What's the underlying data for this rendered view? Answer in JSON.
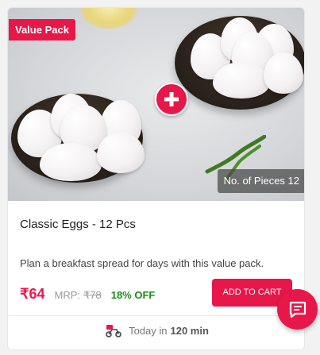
{
  "product": {
    "badge": "Value Pack",
    "pieces_label": "No. of Pieces 12",
    "title": "Classic Eggs - 12 Pcs",
    "description": "Plan a breakfast spread for days with this value pack.",
    "price": "₹64",
    "mrp_label": "MRP:",
    "mrp": "₹78",
    "discount": "18% OFF",
    "add_to_cart": "ADD TO CART"
  },
  "delivery": {
    "prefix": "Today in",
    "time": "120 min",
    "icon": "scooter-icon"
  },
  "colors": {
    "accent": "#e8174a",
    "discount": "#1d8a1d"
  },
  "icons": {
    "plus": "plus-icon",
    "chat": "chat-icon"
  }
}
